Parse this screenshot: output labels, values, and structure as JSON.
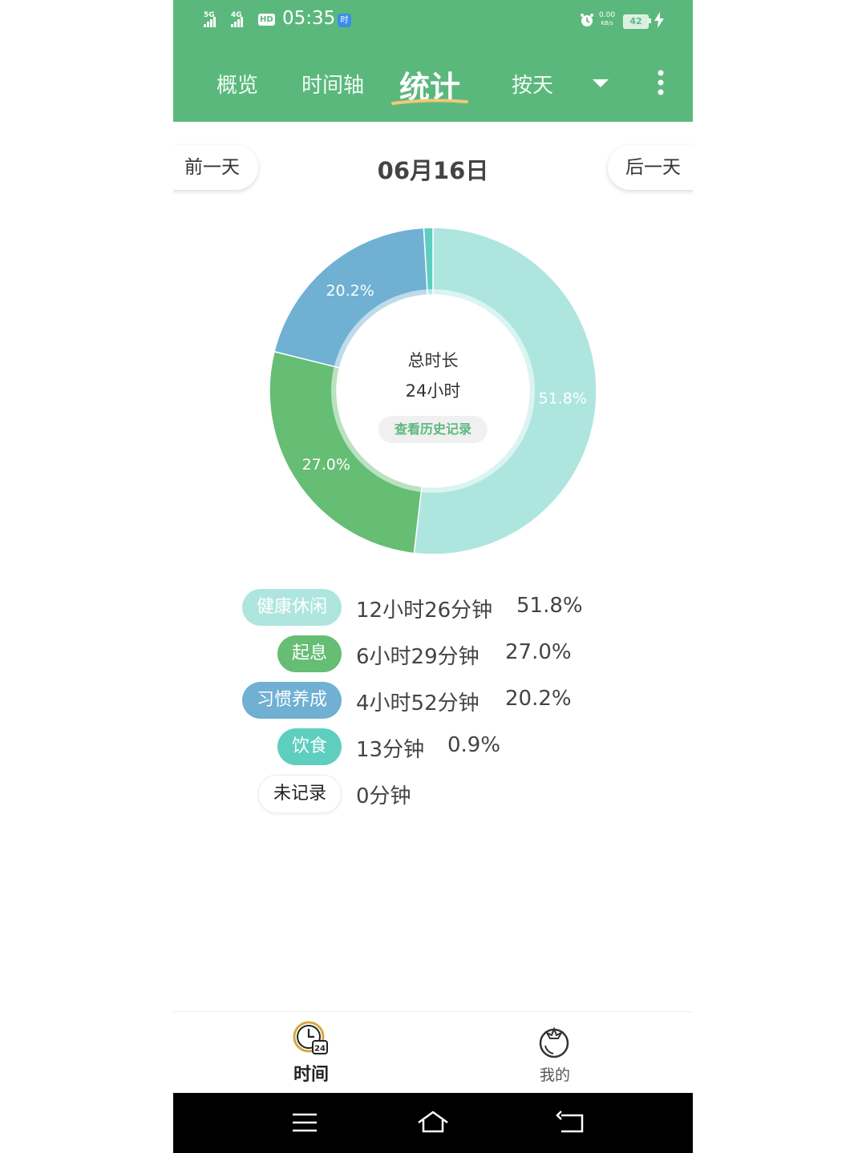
{
  "status_bar": {
    "network_1": "5G",
    "network_2": "4G",
    "hd": "HD",
    "time": "05:35",
    "app_badge": "时",
    "speed_value": "0.00",
    "speed_unit": "KB/s",
    "battery": "42"
  },
  "tabs": {
    "overview": "概览",
    "timeline": "时间轴",
    "stats": "统计",
    "by_day": "按天"
  },
  "date_nav": {
    "prev": "前一天",
    "date": "06月16日",
    "next": "后一天"
  },
  "summary": {
    "title": "总时长",
    "total": "24小时",
    "history_button": "查看历史记录"
  },
  "colors": {
    "header": "#5bb87d",
    "leisure": "#aee6df",
    "rest": "#66bd74",
    "habit": "#6fb0d3",
    "diet": "#5ecfbf"
  },
  "chart_data": {
    "type": "pie",
    "title": "",
    "categories": [
      "健康休闲",
      "起息",
      "习惯养成",
      "饮食",
      "未记录"
    ],
    "values": [
      51.8,
      27.0,
      20.2,
      0.9,
      0
    ],
    "labels": [
      "51.8%",
      "27.0%",
      "20.2%",
      "",
      ""
    ]
  },
  "legend": [
    {
      "name": "健康休闲",
      "duration": "12小时26分钟",
      "percent": "51.8%",
      "color": "#aee6df"
    },
    {
      "name": "起息",
      "duration": "6小时29分钟",
      "percent": "27.0%",
      "color": "#66bd74"
    },
    {
      "name": "习惯养成",
      "duration": "4小时52分钟",
      "percent": "20.2%",
      "color": "#6fb0d3"
    },
    {
      "name": "饮食",
      "duration": "13分钟",
      "percent": "0.9%",
      "color": "#5ecfbf"
    },
    {
      "name": "未记录",
      "duration": "0分钟",
      "percent": "",
      "color": "#ffffff"
    }
  ],
  "bottom_nav": {
    "time": "时间",
    "time_badge": "24",
    "mine": "我的"
  }
}
